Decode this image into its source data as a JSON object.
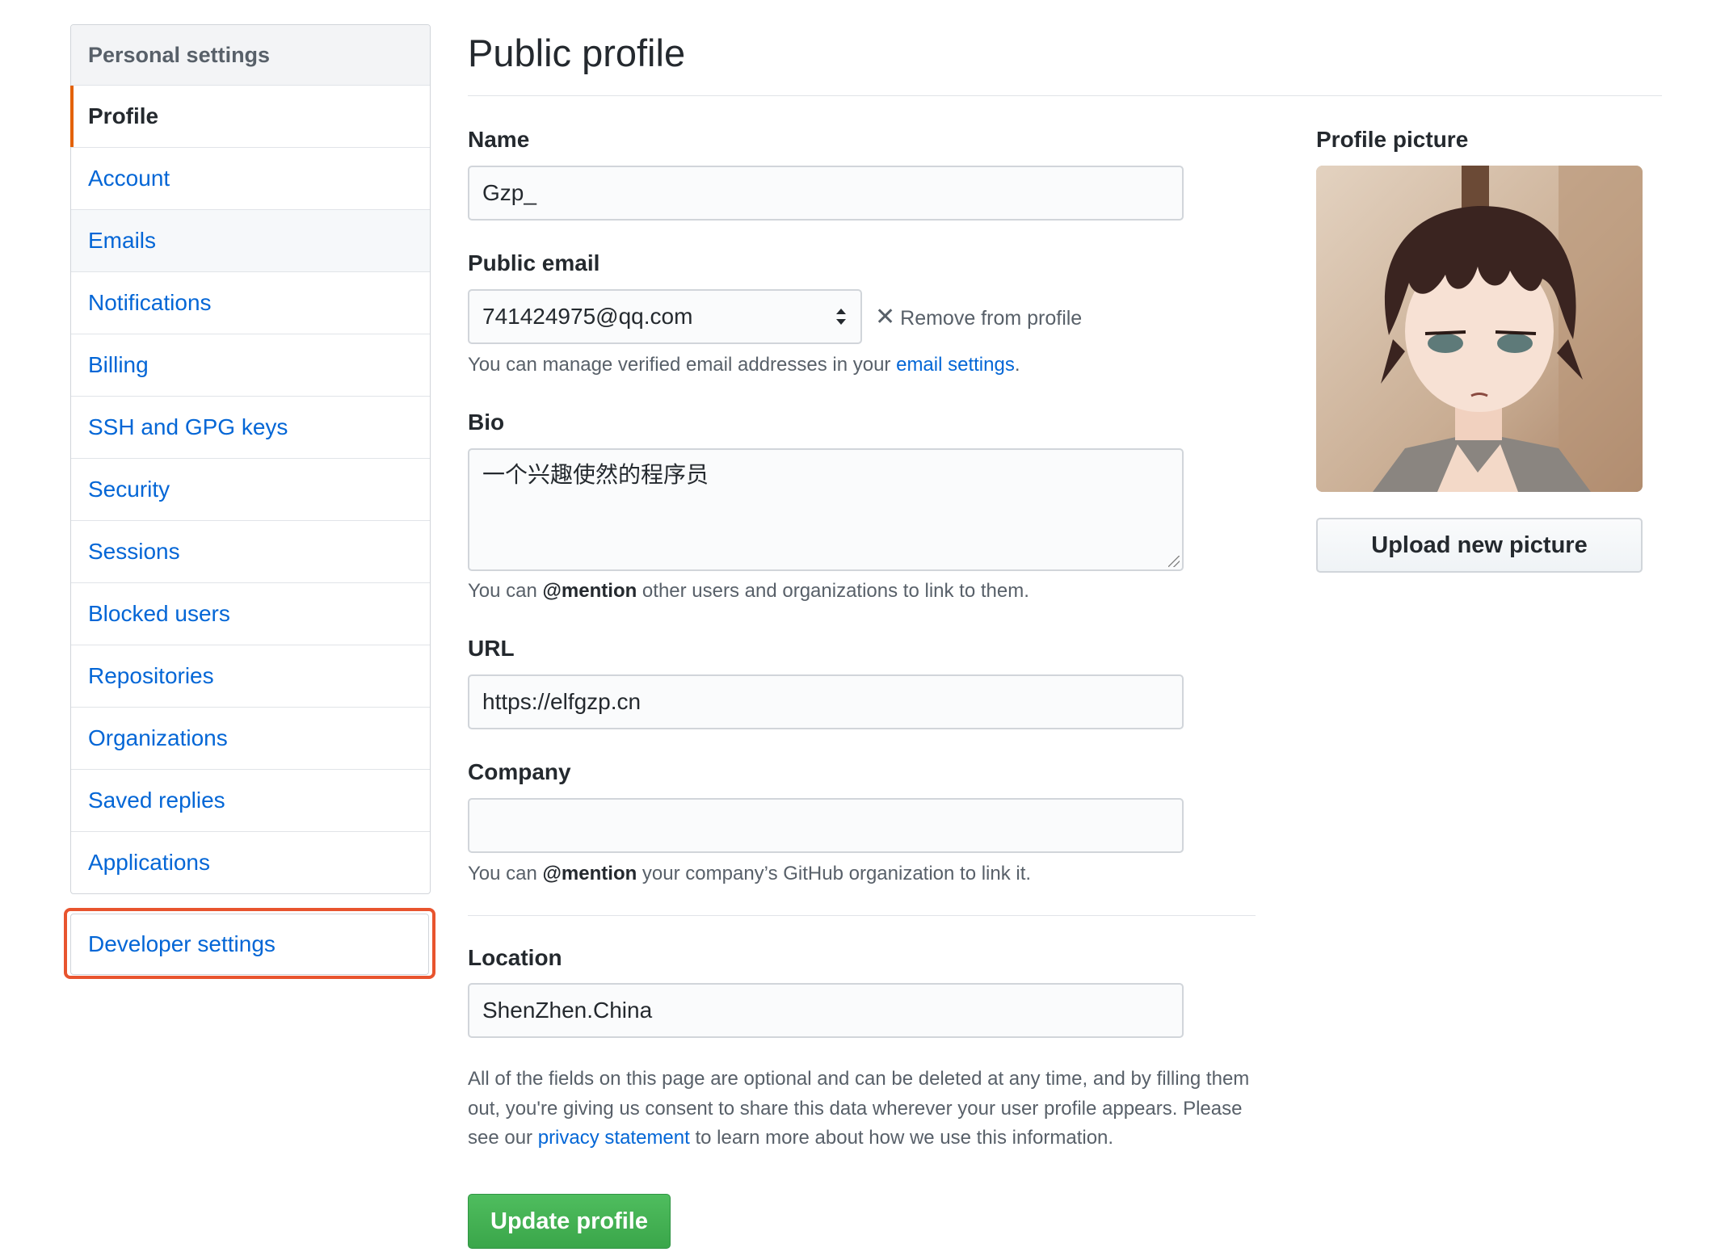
{
  "sidebar": {
    "header": "Personal settings",
    "items": [
      {
        "label": "Profile"
      },
      {
        "label": "Account"
      },
      {
        "label": "Emails"
      },
      {
        "label": "Notifications"
      },
      {
        "label": "Billing"
      },
      {
        "label": "SSH and GPG keys"
      },
      {
        "label": "Security"
      },
      {
        "label": "Sessions"
      },
      {
        "label": "Blocked users"
      },
      {
        "label": "Repositories"
      },
      {
        "label": "Organizations"
      },
      {
        "label": "Saved replies"
      },
      {
        "label": "Applications"
      }
    ],
    "selected": "Profile",
    "developer_settings": "Developer settings"
  },
  "main": {
    "title": "Public profile",
    "name": {
      "label": "Name",
      "value": "Gzp_"
    },
    "public_email": {
      "label": "Public email",
      "value": "741424975@qq.com",
      "remove_label": "Remove from profile",
      "note_prefix": "You can manage verified email addresses in your ",
      "note_link": "email settings",
      "note_suffix": "."
    },
    "bio": {
      "label": "Bio",
      "value": "一个兴趣使然的程序员",
      "note_prefix": "You can ",
      "note_mention": "@mention",
      "note_suffix": " other users and organizations to link to them."
    },
    "url": {
      "label": "URL",
      "value": "https://elfgzp.cn"
    },
    "company": {
      "label": "Company",
      "value": "",
      "note_prefix": "You can ",
      "note_mention": "@mention",
      "note_suffix": " your company’s GitHub organization to link it."
    },
    "location": {
      "label": "Location",
      "value": "ShenZhen.China"
    },
    "disclaimer": {
      "prefix": "All of the fields on this page are optional and can be deleted at any time, and by filling them out, you're giving us consent to share this data wherever your user profile appears. Please see our ",
      "link": "privacy statement",
      "suffix": " to learn more about how we use this information."
    },
    "update_button": "Update profile"
  },
  "profile_picture": {
    "label": "Profile picture",
    "upload_button": "Upload new picture"
  },
  "colors": {
    "link": "#0366d6",
    "selected_indicator": "#e36209",
    "highlight_box": "#e8542e",
    "primary_button": "#3aa64a"
  }
}
